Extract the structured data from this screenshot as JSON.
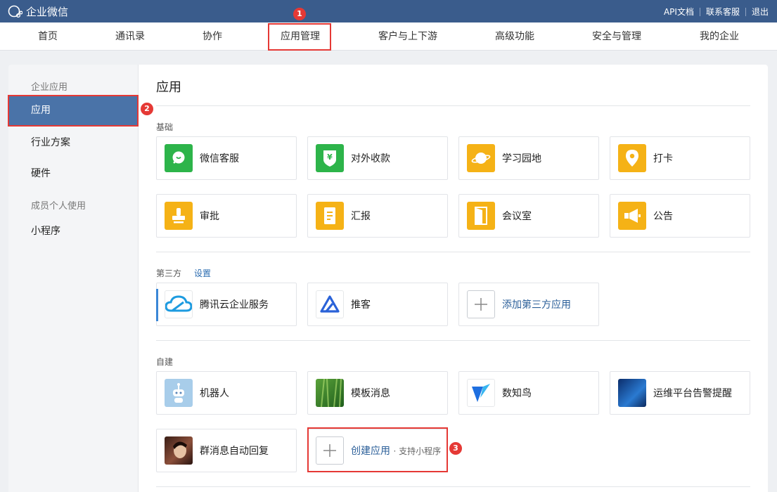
{
  "topbar": {
    "brand": "企业微信",
    "links": [
      "API文档",
      "联系客服",
      "退出"
    ]
  },
  "nav": {
    "tabs": [
      "首页",
      "通讯录",
      "协作",
      "应用管理",
      "客户与上下游",
      "高级功能",
      "安全与管理",
      "我的企业"
    ],
    "active": "应用管理"
  },
  "sidebar": {
    "group1": "企业应用",
    "items": [
      "应用",
      "行业方案",
      "硬件"
    ],
    "group2": "成员个人使用",
    "item_mini": "小程序"
  },
  "main": {
    "title": "应用",
    "basic": {
      "label": "基础",
      "apps": [
        "微信客服",
        "对外收款",
        "学习园地",
        "打卡",
        "审批",
        "汇报",
        "会议室",
        "公告"
      ]
    },
    "third": {
      "label": "第三方",
      "setting": "设置",
      "apps": [
        "腾讯云企业服务",
        "推客"
      ],
      "add": "添加第三方应用"
    },
    "custom": {
      "label": "自建",
      "apps": [
        "机器人",
        "模板消息",
        "数知鸟",
        "运维平台告警提醒",
        "群消息自动回复"
      ],
      "create": "创建应用",
      "create_sub": "· 支持小程序"
    }
  },
  "annotations": [
    "1",
    "2",
    "3"
  ],
  "colors": {
    "topbar": "#3a5c8c",
    "active_side": "#4a73a8",
    "green": "#2db44a",
    "yellow": "#f5b216",
    "annotation": "#e53935"
  }
}
